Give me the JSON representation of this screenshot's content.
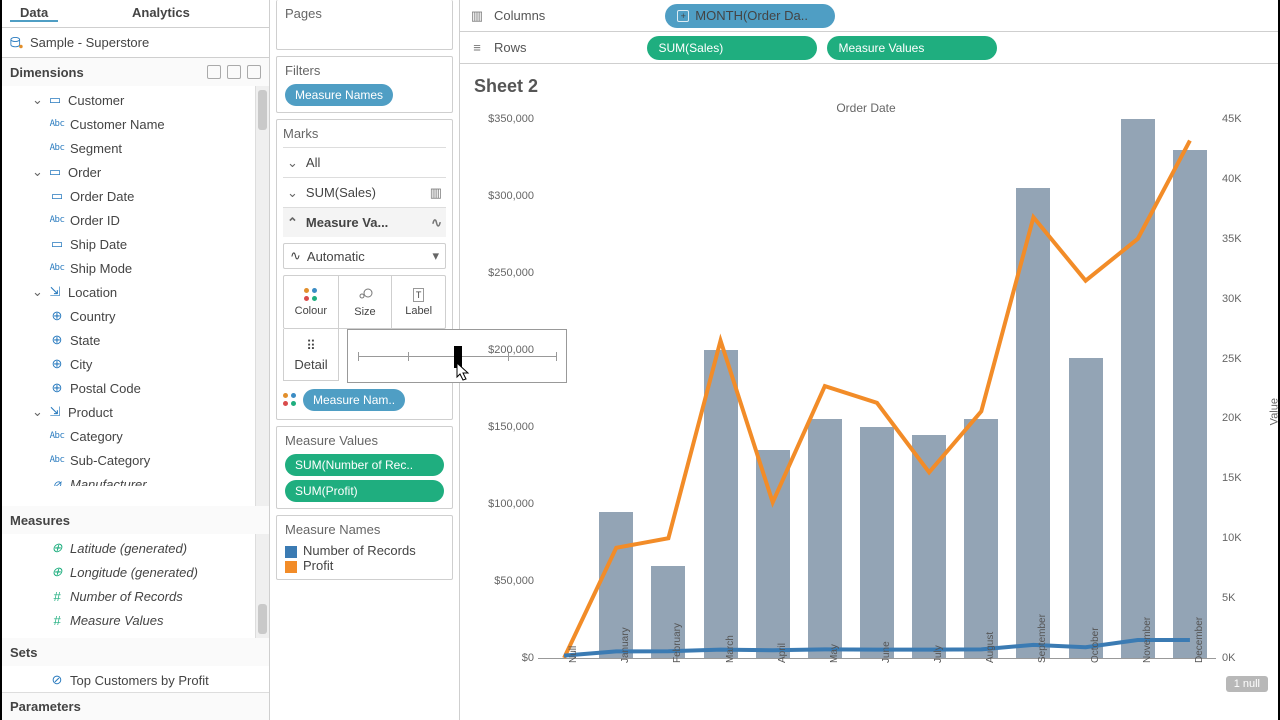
{
  "tabs": {
    "data": "Data",
    "analytics": "Analytics"
  },
  "datasource": "Sample - Superstore",
  "dim_title": "Dimensions",
  "dimtree": {
    "customer": "Customer",
    "customer_name": "Customer Name",
    "segment": "Segment",
    "order": "Order",
    "order_date": "Order Date",
    "order_id": "Order ID",
    "ship_date": "Ship Date",
    "ship_mode": "Ship Mode",
    "location": "Location",
    "country": "Country",
    "state": "State",
    "city": "City",
    "postal": "Postal Code",
    "product": "Product",
    "category": "Category",
    "subcat": "Sub-Category",
    "manuf": "Manufacturer"
  },
  "meas_title": "Measures",
  "measures": {
    "lat": "Latitude (generated)",
    "lon": "Longitude (generated)",
    "nrec": "Number of Records",
    "mvals": "Measure Values"
  },
  "sets_title": "Sets",
  "sets": {
    "top": "Top Customers by Profit"
  },
  "params_title": "Parameters",
  "pages_title": "Pages",
  "filters_title": "Filters",
  "filter_pill": "Measure Names",
  "marks_title": "Marks",
  "marks": {
    "all": "All",
    "sales": "SUM(Sales)",
    "mvals": "Measure Va..."
  },
  "marktype_sel": "Automatic",
  "mark_cells": {
    "colour": "Colour",
    "size": "Size",
    "label": "Label",
    "detail": "Detail"
  },
  "colour_pill": "Measure Nam..",
  "mv_title": "Measure Values",
  "mv_pill1": "SUM(Number of Rec..",
  "mv_pill2": "SUM(Profit)",
  "mn_title": "Measure Names",
  "legend": {
    "nrec": "Number of Records",
    "profit": "Profit"
  },
  "columns_lbl": "Columns",
  "rows_lbl": "Rows",
  "col_pill": "MONTH(Order Da..",
  "row_pill1": "SUM(Sales)",
  "row_pill2": "Measure Values",
  "sheet_title": "Sheet 2",
  "x_axis_title": "Order Date",
  "right_axis_title": "Value",
  "null_badge": "1 null",
  "chart_data": {
    "type": "bar+line",
    "categories": [
      "Null",
      "January",
      "February",
      "March",
      "April",
      "May",
      "June",
      "July",
      "August",
      "September",
      "October",
      "November",
      "December"
    ],
    "bar_series": {
      "name": "Sales",
      "axis": "left",
      "values": [
        0,
        95000,
        60000,
        200000,
        135000,
        155000,
        150000,
        145000,
        155000,
        305000,
        195000,
        350000,
        330000
      ]
    },
    "line_series": [
      {
        "name": "Profit",
        "axis": "right",
        "color": "#f28c28",
        "values": [
          0,
          9200,
          10000,
          26500,
          13000,
          22700,
          21300,
          15500,
          20600,
          36800,
          31500,
          35000,
          43200
        ]
      },
      {
        "name": "Number of Records",
        "axis": "right",
        "color": "#3b7bb3",
        "values": [
          200,
          550,
          560,
          700,
          650,
          720,
          700,
          700,
          720,
          1100,
          900,
          1500,
          1500
        ]
      }
    ],
    "left_axis": {
      "label": "",
      "ticks": [
        0,
        50000,
        100000,
        150000,
        200000,
        250000,
        300000,
        350000
      ],
      "fmt": [
        "$0",
        "$50,000",
        "$100,000",
        "$150,000",
        "$200,000",
        "$250,000",
        "$300,000",
        "$350,000"
      ]
    },
    "right_axis": {
      "label": "Value",
      "ticks": [
        0,
        5000,
        10000,
        15000,
        20000,
        25000,
        30000,
        35000,
        40000,
        45000
      ],
      "fmt": [
        "0K",
        "5K",
        "10K",
        "15K",
        "20K",
        "25K",
        "30K",
        "35K",
        "40K",
        "45K"
      ]
    },
    "x_axis_title": "Order Date",
    "title": "Sheet 2"
  }
}
